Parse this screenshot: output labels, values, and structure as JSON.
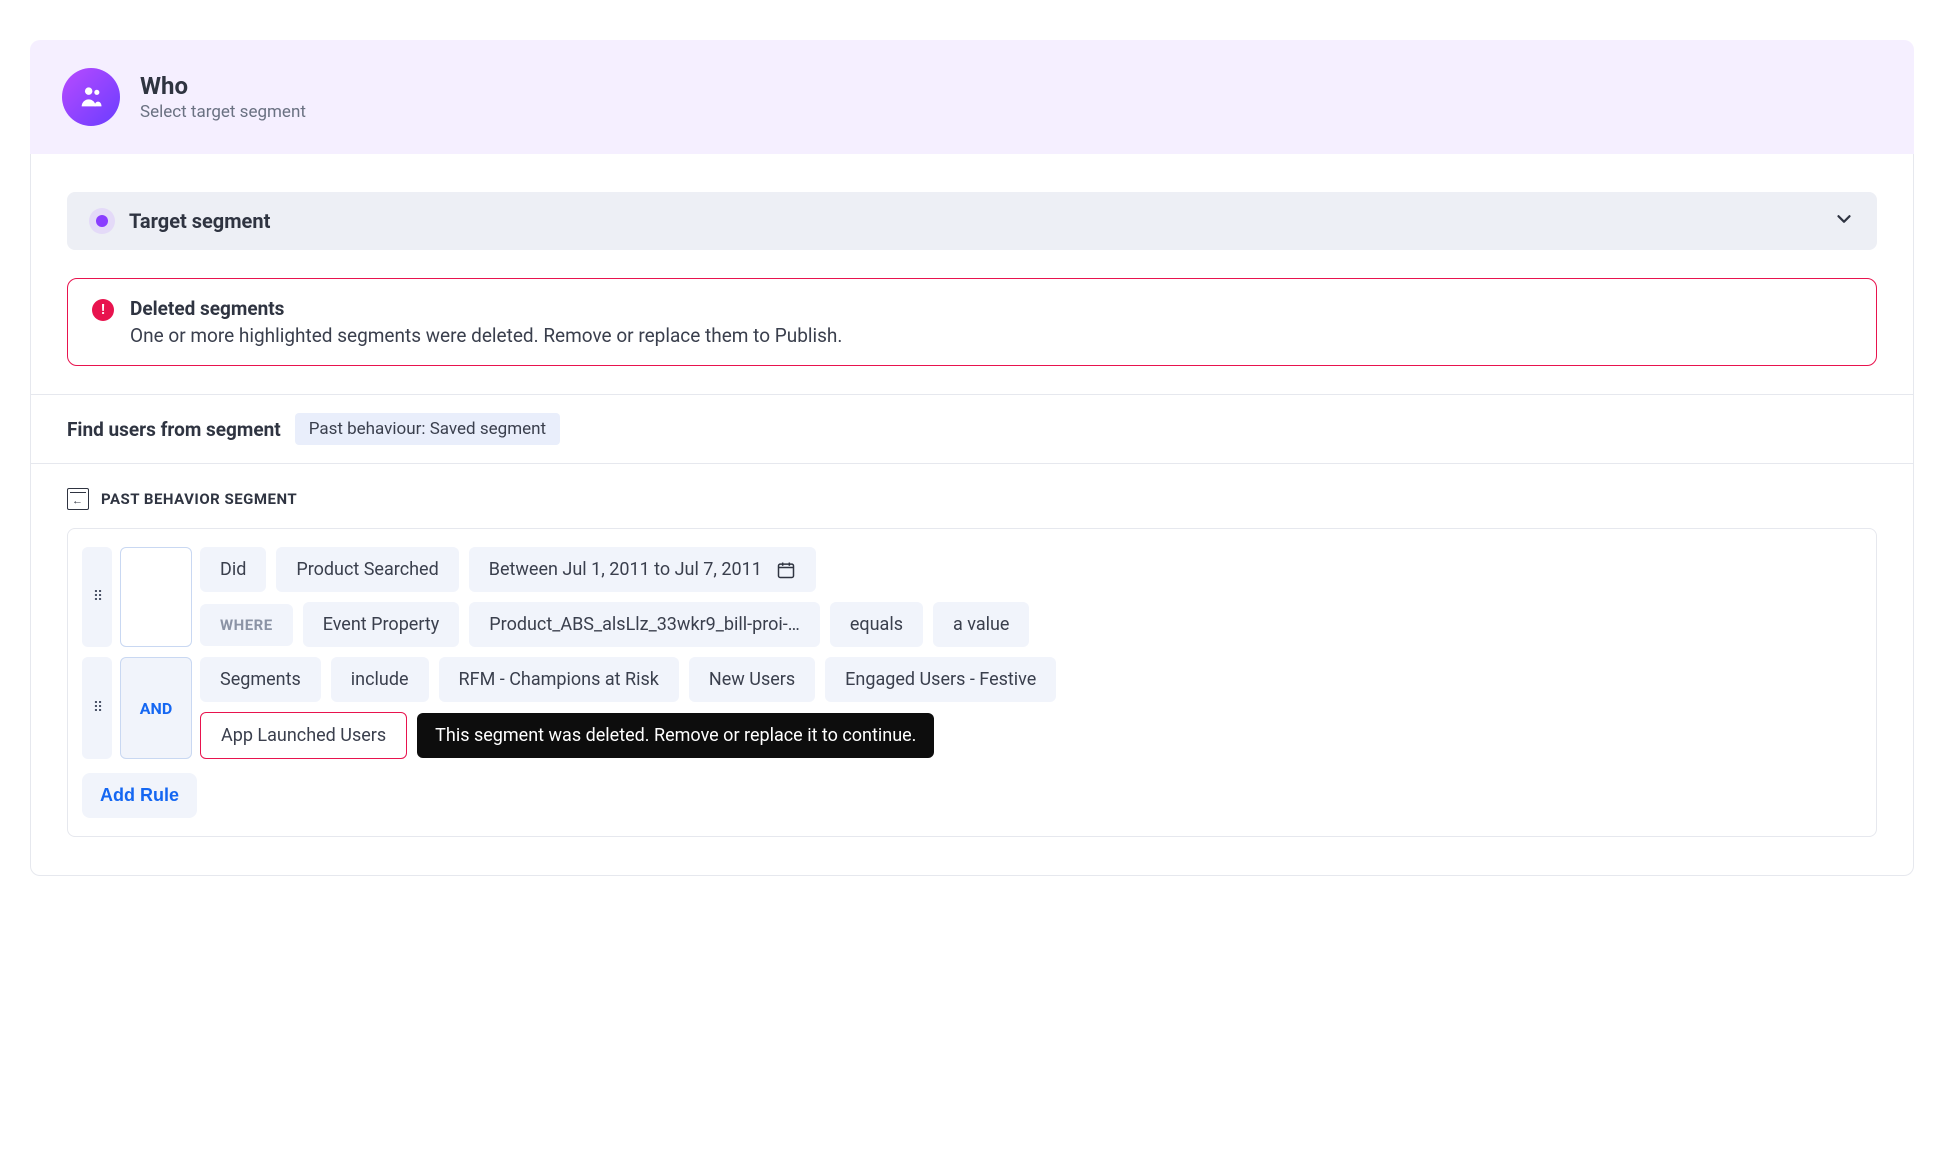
{
  "header": {
    "title": "Who",
    "subtitle": "Select target segment"
  },
  "section": {
    "title": "Target segment"
  },
  "alert": {
    "title": "Deleted segments",
    "body": "One or more highlighted segments were deleted. Remove or replace them to Publish."
  },
  "find": {
    "label": "Find users from segment",
    "pill": "Past behaviour: Saved segment"
  },
  "pbs": {
    "title": "PAST BEHAVIOR SEGMENT"
  },
  "rule1": {
    "row1": {
      "did": "Did",
      "event": "Product Searched",
      "date": "Between Jul 1, 2011 to Jul 7, 2011"
    },
    "row2": {
      "where": "WHERE",
      "prop_label": "Event Property",
      "prop_value": "Product_ABS_alsLlz_33wkr9_bill-proi-…",
      "op": "equals",
      "val": "a value"
    }
  },
  "rule2": {
    "connector": "AND",
    "row1": {
      "segments": "Segments",
      "include": "include",
      "s1": "RFM - Champions at Risk",
      "s2": "New Users",
      "s3": "Engaged Users - Festive"
    },
    "row2": {
      "deleted": "App Launched Users",
      "tooltip": "This segment was deleted. Remove or replace it to continue."
    }
  },
  "add_rule": "Add Rule"
}
